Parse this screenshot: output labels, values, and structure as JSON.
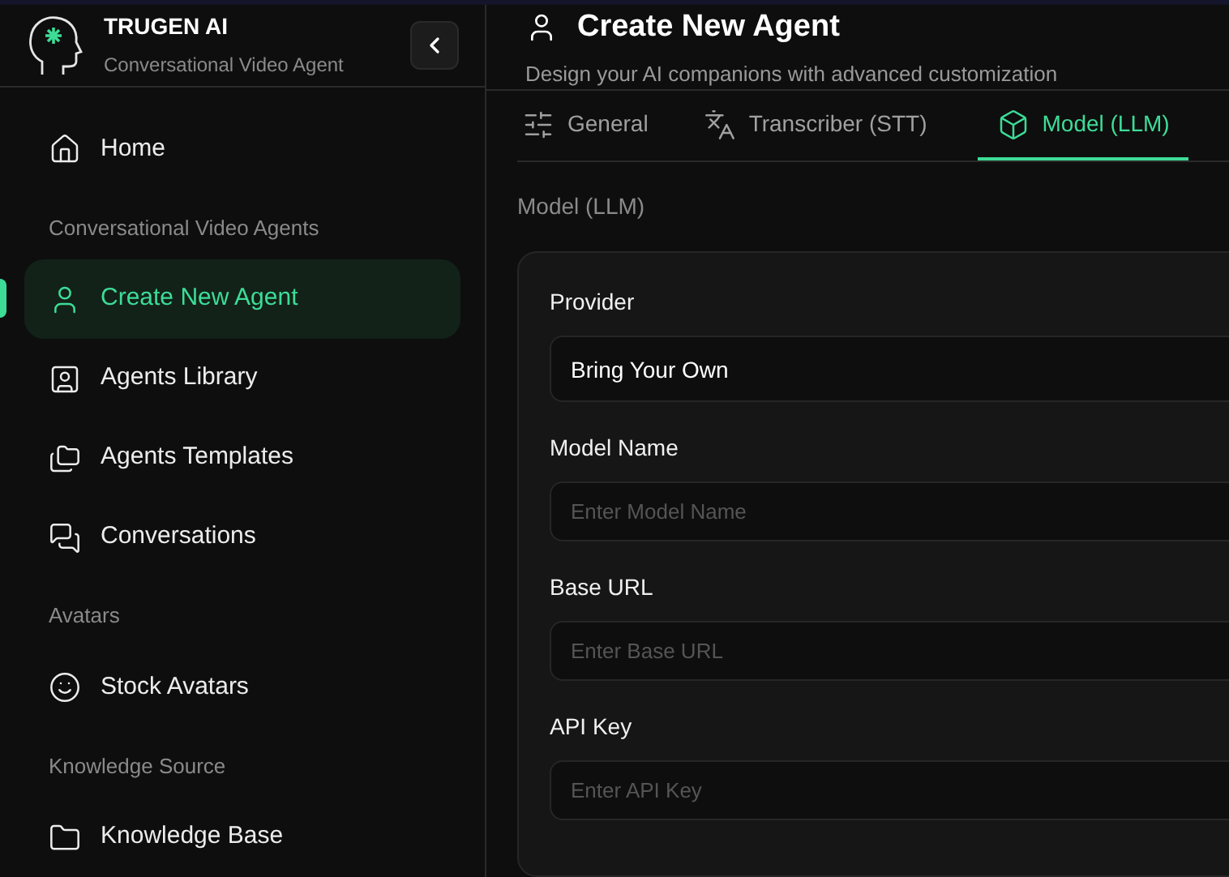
{
  "brand": {
    "name": "TRUGEN AI",
    "tagline": "Conversational Video Agent"
  },
  "nav": [
    {
      "kind": "link",
      "label": "Home",
      "selected": false
    },
    {
      "kind": "heading",
      "label": "Conversational Video Agents"
    },
    {
      "kind": "link",
      "label": "Create New Agent",
      "selected": true
    },
    {
      "kind": "link",
      "label": "Agents Library",
      "selected": false
    },
    {
      "kind": "link",
      "label": "Agents Templates",
      "selected": false
    },
    {
      "kind": "link",
      "label": "Conversations",
      "selected": false
    },
    {
      "kind": "heading",
      "label": "Avatars"
    },
    {
      "kind": "link",
      "label": "Stock Avatars",
      "selected": false
    },
    {
      "kind": "heading",
      "label": "Knowledge Source"
    },
    {
      "kind": "link",
      "label": "Knowledge Base",
      "selected": false
    }
  ],
  "page": {
    "title": "Create New Agent",
    "subtitle": "Design your AI companions with advanced customization"
  },
  "tabs": [
    {
      "label": "General",
      "selected": false
    },
    {
      "label": "Transcriber (STT)",
      "selected": false
    },
    {
      "label": "Model (LLM)",
      "selected": true
    }
  ],
  "section_title": "Model (LLM)",
  "fields": [
    {
      "label": "Provider",
      "value": "Bring Your Own"
    },
    {
      "label": "Model Name",
      "placeholder": "Enter Model Name"
    },
    {
      "label": "Base URL",
      "placeholder": "Enter Base URL"
    },
    {
      "label": "API Key",
      "placeholder": "Enter API Key"
    }
  ]
}
